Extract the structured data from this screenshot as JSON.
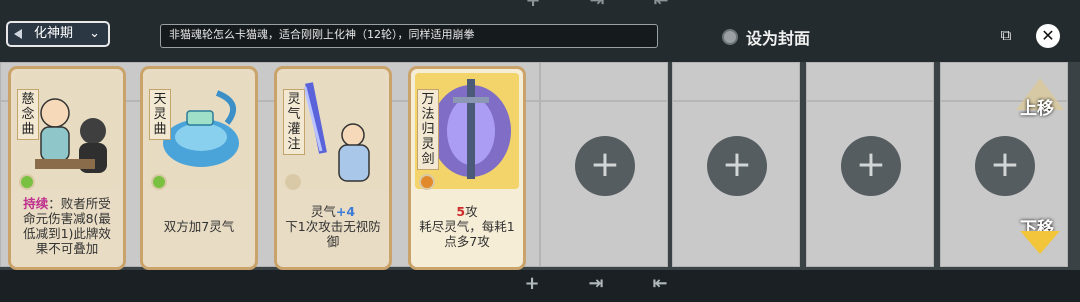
{
  "header": {
    "realm_selector": "化神期",
    "note": "非猫魂轮怎么卡猫魂，适合刚刚上化神（12轮），同样适用崩拳",
    "set_cover_label": "设为封面"
  },
  "cards": [
    {
      "name": "慈念曲",
      "desc_keyword": "持续",
      "desc_rest": "：败者所受命元伤害减8(最低减到1)此牌效果不可叠加",
      "gem_color": "#7ac142"
    },
    {
      "name": "天灵曲",
      "desc": "双方加7灵气",
      "gem_color": "#7ac142"
    },
    {
      "name": "灵气灌注",
      "desc_a": "灵气",
      "desc_a_num": "+4",
      "desc_b": "下1次攻击无视防御",
      "gem_color": "#d9c9a6"
    },
    {
      "name": "万法归灵剑",
      "atk_num": "5",
      "atk_label": "攻",
      "desc": "耗尽灵气，每耗1点多7攻",
      "gem_color": "#e28a2b"
    }
  ],
  "empty_slots": [
    {
      "icon": "plus-icon"
    },
    {
      "icon": "plus-icon"
    },
    {
      "icon": "plus-icon"
    },
    {
      "icon": "plus-icon"
    }
  ],
  "controls": {
    "move_up": "上移",
    "move_down": "下移"
  }
}
